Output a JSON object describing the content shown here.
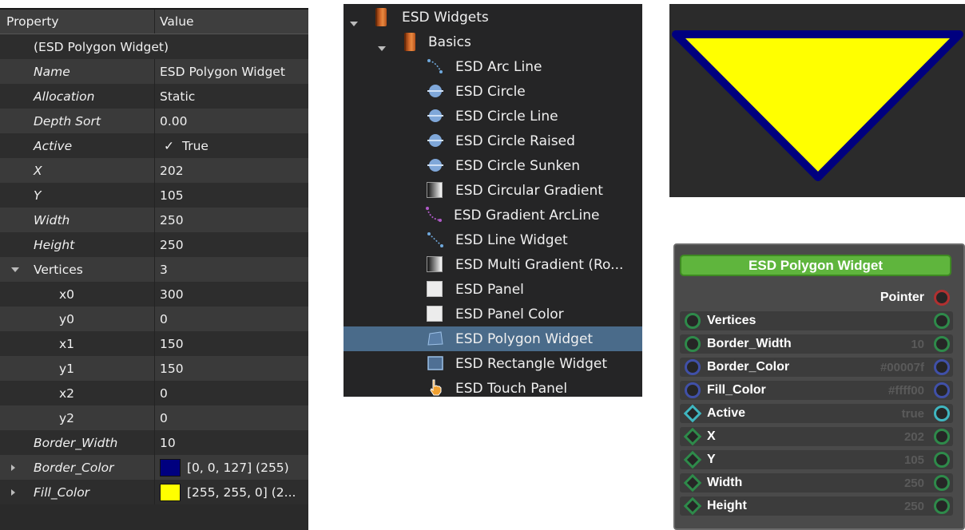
{
  "property_grid": {
    "header": {
      "property": "Property",
      "value": "Value"
    },
    "object_title": "(ESD Polygon Widget)",
    "rows": [
      {
        "name": "Name",
        "value": "ESD Polygon Widget"
      },
      {
        "name": "Allocation",
        "value": "Static"
      },
      {
        "name": "Depth Sort",
        "value": "0.00"
      },
      {
        "name": "Active",
        "check": "✓",
        "value": "True"
      },
      {
        "name": "X",
        "value": "202"
      },
      {
        "name": "Y",
        "value": "105"
      },
      {
        "name": "Width",
        "value": "250"
      },
      {
        "name": "Height",
        "value": "250"
      },
      {
        "name": "Vertices",
        "value": "3"
      },
      {
        "name": "x0",
        "value": "300"
      },
      {
        "name": "y0",
        "value": "0"
      },
      {
        "name": "x1",
        "value": "150"
      },
      {
        "name": "y1",
        "value": "150"
      },
      {
        "name": "x2",
        "value": "0"
      },
      {
        "name": "y2",
        "value": "0"
      },
      {
        "name": "Border_Width",
        "value": "10"
      },
      {
        "name": "Border_Color",
        "value": "[0, 0, 127] (255)",
        "color": "#00007f"
      },
      {
        "name": "Fill_Color",
        "value": "[255, 255, 0] (2...",
        "color": "#ffff00"
      }
    ]
  },
  "tree": {
    "root": "ESD Widgets",
    "group": "Basics",
    "items": [
      {
        "label": "ESD Arc Line",
        "icon": "arc-line-icon"
      },
      {
        "label": "ESD Circle",
        "icon": "circle-icon"
      },
      {
        "label": "ESD Circle Line",
        "icon": "circle-line-icon"
      },
      {
        "label": "ESD Circle Raised",
        "icon": "circle-raised-icon"
      },
      {
        "label": "ESD Circle Sunken",
        "icon": "circle-sunken-icon"
      },
      {
        "label": "ESD Circular Gradient",
        "icon": "circular-gradient-icon"
      },
      {
        "label": "ESD Gradient ArcLine",
        "icon": "gradient-arcline-icon"
      },
      {
        "label": "ESD Line Widget",
        "icon": "line-widget-icon"
      },
      {
        "label": "ESD Multi Gradient (Ro...",
        "icon": "multi-gradient-icon"
      },
      {
        "label": "ESD Panel",
        "icon": "panel-icon"
      },
      {
        "label": "ESD Panel Color",
        "icon": "panel-color-icon"
      },
      {
        "label": "ESD Polygon Widget",
        "icon": "polygon-widget-icon",
        "selected": true
      },
      {
        "label": "ESD Rectangle Widget",
        "icon": "rectangle-widget-icon"
      },
      {
        "label": "ESD Touch Panel",
        "icon": "touch-panel-icon"
      }
    ]
  },
  "preview": {
    "fill_color": "#ffff00",
    "border_color": "#00007f",
    "background": "#2b2b2b"
  },
  "node": {
    "title": "ESD Polygon Widget",
    "output": "Pointer",
    "rows": [
      {
        "label": "Vertices",
        "value": "",
        "pin": "circle-green"
      },
      {
        "label": "Border_Width",
        "value": "10",
        "pin": "circle-green"
      },
      {
        "label": "Border_Color",
        "value": "#00007f",
        "pin": "circle-blue"
      },
      {
        "label": "Fill_Color",
        "value": "#ffff00",
        "pin": "circle-blue"
      },
      {
        "label": "Active",
        "value": "true",
        "pin": "diamond-cyan"
      },
      {
        "label": "X",
        "value": "202",
        "pin": "diamond-green"
      },
      {
        "label": "Y",
        "value": "105",
        "pin": "diamond-green"
      },
      {
        "label": "Width",
        "value": "250",
        "pin": "diamond-green"
      },
      {
        "label": "Height",
        "value": "250",
        "pin": "diamond-green"
      }
    ]
  }
}
